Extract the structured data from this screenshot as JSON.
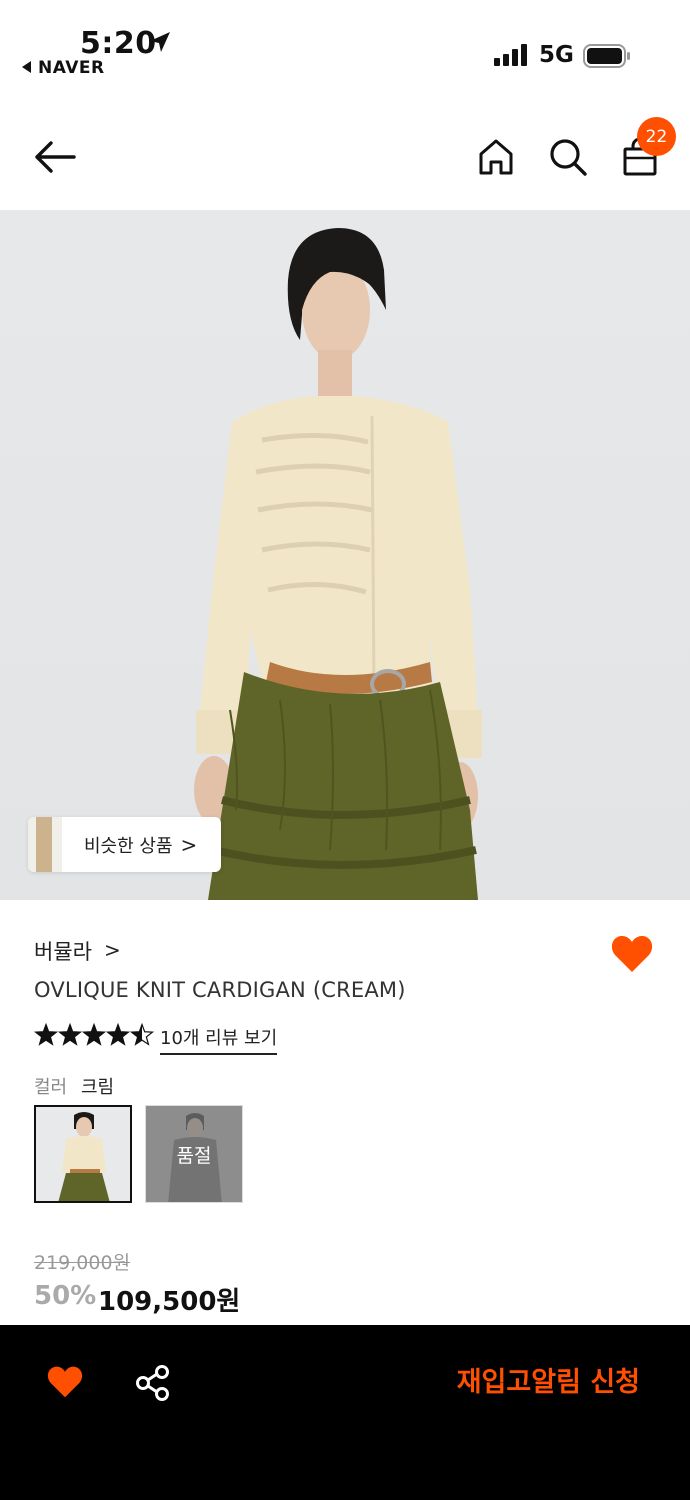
{
  "status_bar": {
    "time": "5:20",
    "back_app": "NAVER",
    "network": "5G"
  },
  "header": {
    "cart_count": "22",
    "icons": [
      "back-arrow-icon",
      "home-icon",
      "search-icon",
      "shopping-bag-icon"
    ]
  },
  "hero": {
    "similar_label": "비슷한 상품",
    "similar_chevron": ">"
  },
  "product": {
    "brand": "버뮬라",
    "brand_chevron": ">",
    "name": "OVLIQUE KNIT CARDIGAN (CREAM)",
    "rating": 4.5,
    "review_link": "10개 리뷰 보기",
    "color_label": "컬러",
    "color_value": "크림",
    "swatches": [
      {
        "state": "selected"
      },
      {
        "state": "sold-out",
        "label": "품절"
      }
    ],
    "original_price": "219,000원",
    "discount": "50%",
    "sale_price": "109,500원"
  },
  "bottom_bar": {
    "restock_button": "재입고알림 신청"
  },
  "colors": {
    "accent": "#ff4f00",
    "bottom_bar_bg": "#000000"
  }
}
